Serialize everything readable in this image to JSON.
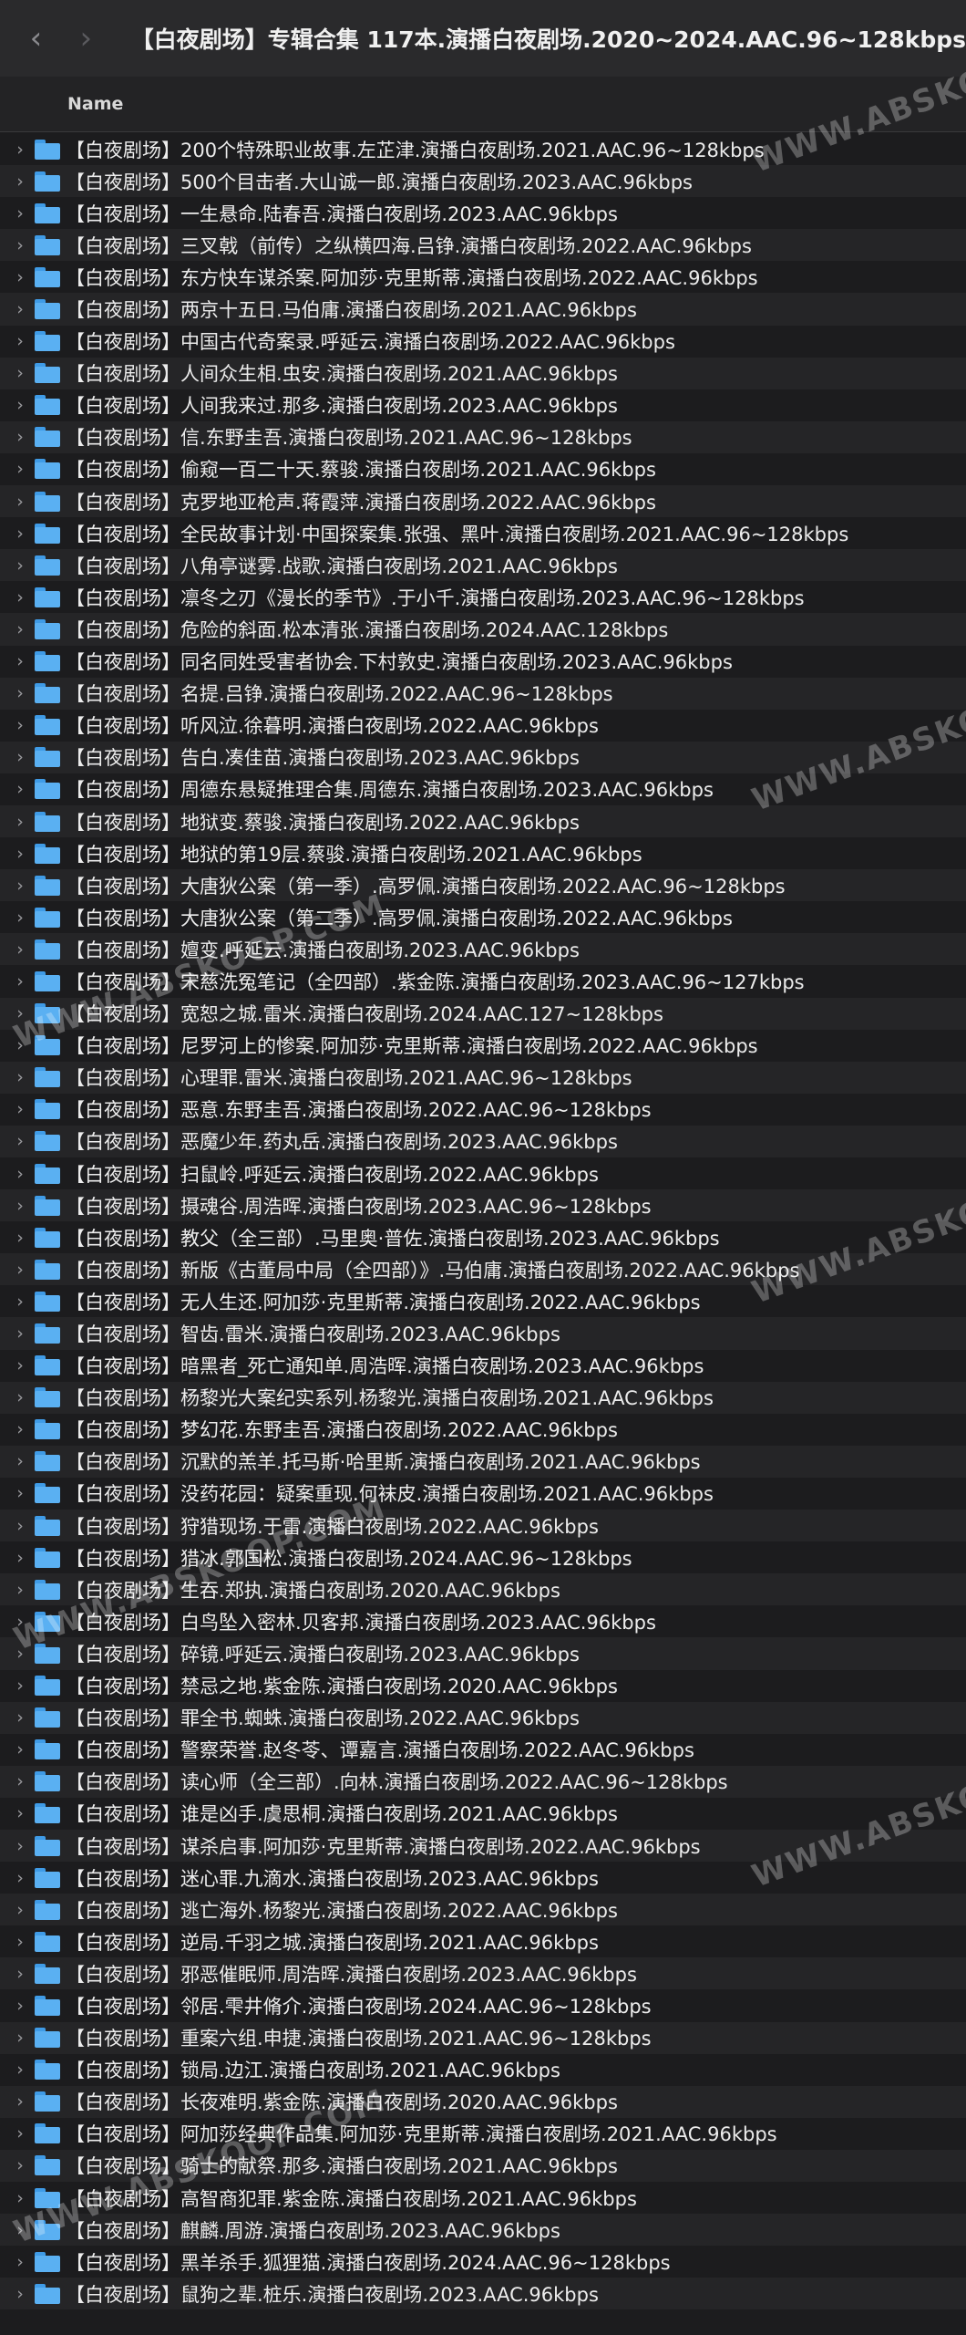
{
  "toolbar": {
    "back_icon": "chevron-left-icon",
    "forward_icon": "chevron-right-icon",
    "title": "【白夜剧场】专辑合集 117本.演播白夜剧场.2020~2024.AAC.96~128kbps"
  },
  "column_header": {
    "name": "Name"
  },
  "files": [
    "【白夜剧场】200个特殊职业故事.左芷津.演播白夜剧场.2021.AAC.96~128kbps",
    "【白夜剧场】500个目击者.大山诚一郎.演播白夜剧场.2023.AAC.96kbps",
    "【白夜剧场】一生悬命.陆春吾.演播白夜剧场.2023.AAC.96kbps",
    "【白夜剧场】三叉戟（前传）之纵横四海.吕铮.演播白夜剧场.2022.AAC.96kbps",
    "【白夜剧场】东方快车谋杀案.阿加莎·克里斯蒂.演播白夜剧场.2022.AAC.96kbps",
    "【白夜剧场】两京十五日.马伯庸.演播白夜剧场.2021.AAC.96kbps",
    "【白夜剧场】中国古代奇案录.呼延云.演播白夜剧场.2022.AAC.96kbps",
    "【白夜剧场】人间众生相.虫安.演播白夜剧场.2021.AAC.96kbps",
    "【白夜剧场】人间我来过.那多.演播白夜剧场.2023.AAC.96kbps",
    "【白夜剧场】信.东野圭吾.演播白夜剧场.2021.AAC.96~128kbps",
    "【白夜剧场】偷窥一百二十天.蔡骏.演播白夜剧场.2021.AAC.96kbps",
    "【白夜剧场】克罗地亚枪声.蒋霞萍.演播白夜剧场.2022.AAC.96kbps",
    "【白夜剧场】全民故事计划·中国探案集.张强、黑叶.演播白夜剧场.2021.AAC.96~128kbps",
    "【白夜剧场】八角亭谜雾.战歌.演播白夜剧场.2021.AAC.96kbps",
    "【白夜剧场】凛冬之刃《漫长的季节》.于小千.演播白夜剧场.2023.AAC.96~128kbps",
    "【白夜剧场】危险的斜面.松本清张.演播白夜剧场.2024.AAC.128kbps",
    "【白夜剧场】同名同姓受害者协会.下村敦史.演播白夜剧场.2023.AAC.96kbps",
    "【白夜剧场】名提.吕铮.演播白夜剧场.2022.AAC.96~128kbps",
    "【白夜剧场】听风泣.徐暮明.演播白夜剧场.2022.AAC.96kbps",
    "【白夜剧场】告白.凑佳苗.演播白夜剧场.2023.AAC.96kbps",
    "【白夜剧场】周德东悬疑推理合集.周德东.演播白夜剧场.2023.AAC.96kbps",
    "【白夜剧场】地狱变.蔡骏.演播白夜剧场.2022.AAC.96kbps",
    "【白夜剧场】地狱的第19层.蔡骏.演播白夜剧场.2021.AAC.96kbps",
    "【白夜剧场】大唐狄公案（第一季）.高罗佩.演播白夜剧场.2022.AAC.96~128kbps",
    "【白夜剧场】大唐狄公案（第二季）.高罗佩.演播白夜剧场.2022.AAC.96kbps",
    "【白夜剧场】嬗变.呼延云.演播白夜剧场.2023.AAC.96kbps",
    "【白夜剧场】宋慈洗冤笔记（全四部）.紫金陈.演播白夜剧场.2023.AAC.96~127kbps",
    "【白夜剧场】宽恕之城.雷米.演播白夜剧场.2024.AAC.127~128kbps",
    "【白夜剧场】尼罗河上的惨案.阿加莎·克里斯蒂.演播白夜剧场.2022.AAC.96kbps",
    "【白夜剧场】心理罪.雷米.演播白夜剧场.2021.AAC.96~128kbps",
    "【白夜剧场】恶意.东野圭吾.演播白夜剧场.2022.AAC.96~128kbps",
    "【白夜剧场】恶魔少年.药丸岳.演播白夜剧场.2023.AAC.96kbps",
    "【白夜剧场】扫鼠岭.呼延云.演播白夜剧场.2022.AAC.96kbps",
    "【白夜剧场】摄魂谷.周浩晖.演播白夜剧场.2023.AAC.96~128kbps",
    "【白夜剧场】教父（全三部）.马里奥·普佐.演播白夜剧场.2023.AAC.96kbps",
    "【白夜剧场】新版《古董局中局（全四部）》.马伯庸.演播白夜剧场.2022.AAC.96kbps",
    "【白夜剧场】无人生还.阿加莎·克里斯蒂.演播白夜剧场.2022.AAC.96kbps",
    "【白夜剧场】智齿.雷米.演播白夜剧场.2023.AAC.96kbps",
    "【白夜剧场】暗黑者_死亡通知单.周浩晖.演播白夜剧场.2023.AAC.96kbps",
    "【白夜剧场】杨黎光大案纪实系列.杨黎光.演播白夜剧场.2021.AAC.96kbps",
    "【白夜剧场】梦幻花.东野圭吾.演播白夜剧场.2022.AAC.96kbps",
    "【白夜剧场】沉默的羔羊.托马斯·哈里斯.演播白夜剧场.2021.AAC.96kbps",
    "【白夜剧场】没药花园：疑案重现.何袜皮.演播白夜剧场.2021.AAC.96kbps",
    "【白夜剧场】狩猎现场.于雷.演播白夜剧场.2022.AAC.96kbps",
    "【白夜剧场】猎冰.郭国松.演播白夜剧场.2024.AAC.96~128kbps",
    "【白夜剧场】生吞.郑执.演播白夜剧场.2020.AAC.96kbps",
    "【白夜剧场】白鸟坠入密林.贝客邦.演播白夜剧场.2023.AAC.96kbps",
    "【白夜剧场】碎镜.呼延云.演播白夜剧场.2023.AAC.96kbps",
    "【白夜剧场】禁忌之地.紫金陈.演播白夜剧场.2020.AAC.96kbps",
    "【白夜剧场】罪全书.蜘蛛.演播白夜剧场.2022.AAC.96kbps",
    "【白夜剧场】警察荣誉.赵冬苓、谭嘉言.演播白夜剧场.2022.AAC.96kbps",
    "【白夜剧场】读心师（全三部）.向林.演播白夜剧场.2022.AAC.96~128kbps",
    "【白夜剧场】谁是凶手.虞思桐.演播白夜剧场.2021.AAC.96kbps",
    "【白夜剧场】谋杀启事.阿加莎·克里斯蒂.演播白夜剧场.2022.AAC.96kbps",
    "【白夜剧场】迷心罪.九滴水.演播白夜剧场.2023.AAC.96kbps",
    "【白夜剧场】逃亡海外.杨黎光.演播白夜剧场.2022.AAC.96kbps",
    "【白夜剧场】逆局.千羽之城.演播白夜剧场.2021.AAC.96kbps",
    "【白夜剧场】邪恶催眠师.周浩晖.演播白夜剧场.2023.AAC.96kbps",
    "【白夜剧场】邻居.雫井脩介.演播白夜剧场.2024.AAC.96~128kbps",
    "【白夜剧场】重案六组.申捷.演播白夜剧场.2021.AAC.96~128kbps",
    "【白夜剧场】锁局.边江.演播白夜剧场.2021.AAC.96kbps",
    "【白夜剧场】长夜难明.紫金陈.演播白夜剧场.2020.AAC.96kbps",
    "【白夜剧场】阿加莎经典作品集.阿加莎·克里斯蒂.演播白夜剧场.2021.AAC.96kbps",
    "【白夜剧场】骑士的献祭.那多.演播白夜剧场.2021.AAC.96kbps",
    "【白夜剧场】高智商犯罪.紫金陈.演播白夜剧场.2021.AAC.96kbps",
    "【白夜剧场】麒麟.周游.演播白夜剧场.2023.AAC.96kbps",
    "【白夜剧场】黑羊杀手.狐狸猫.演播白夜剧场.2024.AAC.96~128kbps",
    "【白夜剧场】鼠狗之辈.桩乐.演播白夜剧场.2023.AAC.96kbps"
  ],
  "watermark": "WWW.ABSKOOP.COM",
  "colors": {
    "background": "#1c1c1e",
    "folder": "#5ab0f2",
    "text": "#ececec"
  }
}
